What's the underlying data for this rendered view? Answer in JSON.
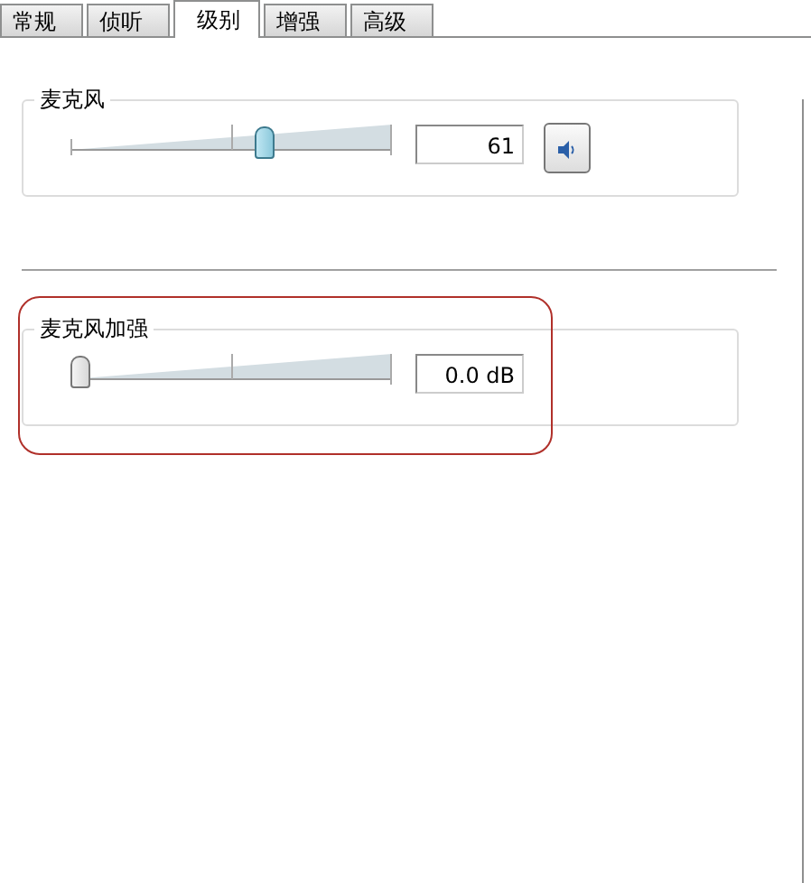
{
  "tabs": [
    {
      "label": "常规",
      "selected": false
    },
    {
      "label": "侦听",
      "selected": false
    },
    {
      "label": "级别",
      "selected": true
    },
    {
      "label": "增强",
      "selected": false
    },
    {
      "label": "高级",
      "selected": false
    }
  ],
  "levels": [
    {
      "name": "麦克风",
      "level": 0.61,
      "reading": "61",
      "muted": false
    },
    {
      "name": "麦克风加强",
      "level": 0,
      "reading": "0.0 dB",
      "highlighted": true
    }
  ]
}
